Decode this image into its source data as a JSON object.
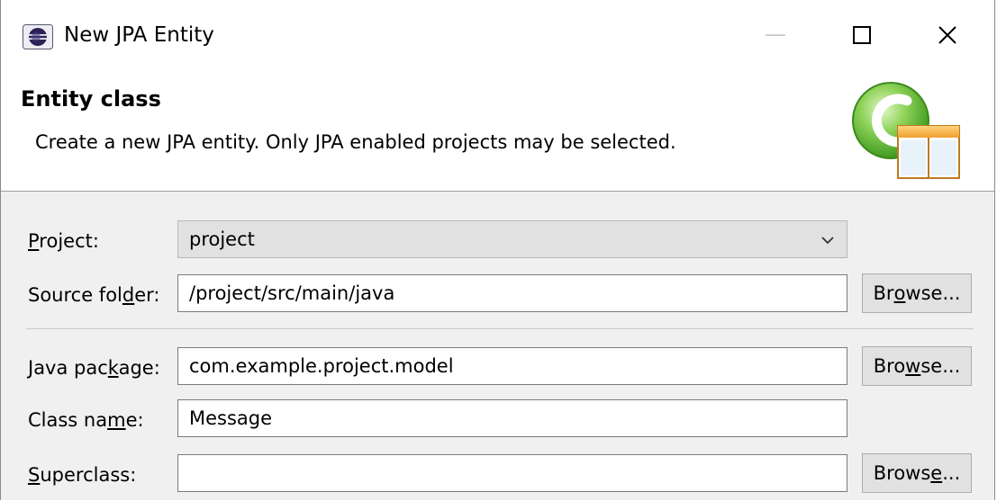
{
  "window": {
    "title": "New JPA Entity",
    "minimize_label": "—",
    "close_label": "✕"
  },
  "banner": {
    "title": "Entity class",
    "description": "Create a new JPA entity. Only JPA enabled projects may be selected."
  },
  "form": {
    "project": {
      "label_pre": "",
      "label_mn": "P",
      "label_post": "roject:",
      "value": "project"
    },
    "source_folder": {
      "label_pre": "Source fol",
      "label_mn": "d",
      "label_post": "er:",
      "value": "/project/src/main/java",
      "browse_pre": "Br",
      "browse_mn": "o",
      "browse_post": "wse..."
    },
    "java_package": {
      "label_pre": "Java pac",
      "label_mn": "k",
      "label_post": "age:",
      "value": "com.example.project.model",
      "browse_pre": "Bro",
      "browse_mn": "w",
      "browse_post": "se..."
    },
    "class_name": {
      "label_pre": "Class na",
      "label_mn": "m",
      "label_post": "e:",
      "value": "Message"
    },
    "superclass": {
      "label_pre": "",
      "label_mn": "S",
      "label_post": "uperclass:",
      "value": "",
      "browse_pre": "Brows",
      "browse_mn": "e",
      "browse_post": "..."
    }
  },
  "icons": {
    "app": "eclipse-icon",
    "wizard": "jpa-entity-wizard-graphic",
    "dropdown": "chevron-down-icon"
  },
  "colors": {
    "dialog_bg": "#f0f0f0",
    "banner_bg": "#ffffff",
    "button_bg": "#e1e1e1",
    "wizard_green": "#5cb82e",
    "wizard_orange": "#f0a030"
  }
}
